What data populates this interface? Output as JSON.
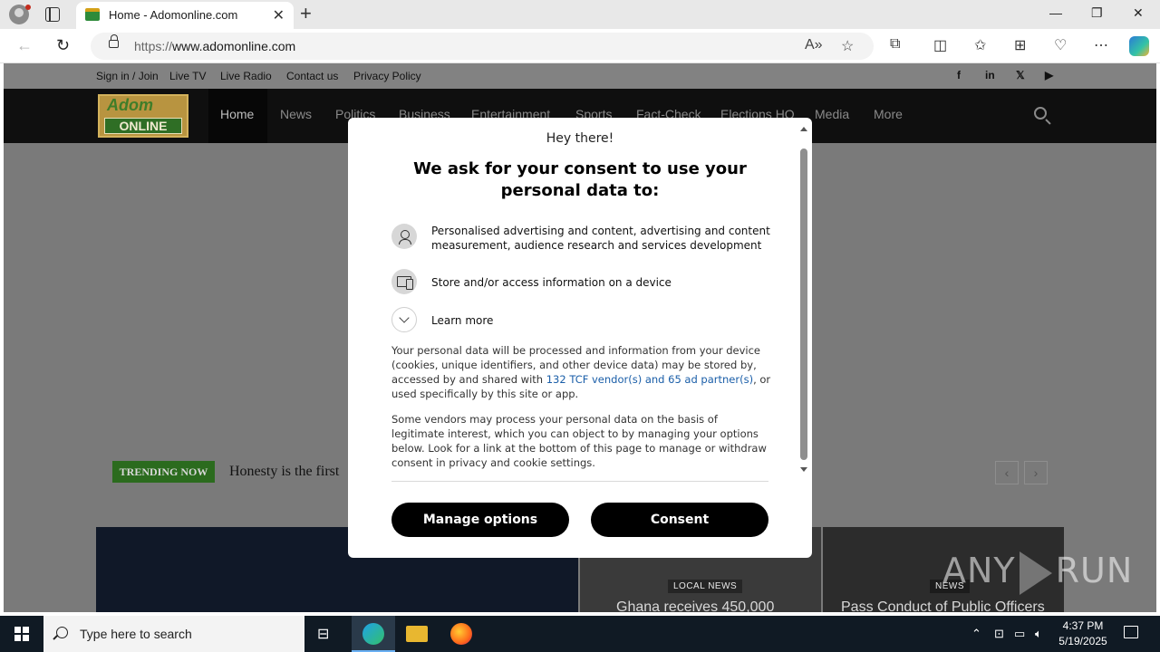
{
  "browser": {
    "tab_title": "Home - Adomonline.com",
    "url_scheme": "https://",
    "url_host": "www.adomonline.com"
  },
  "site": {
    "topbar_links": [
      "Sign in / Join",
      "Live TV",
      "Live Radio",
      "Contact us",
      "Privacy Policy"
    ],
    "social": [
      "f",
      "in",
      "𝕏",
      "▶"
    ],
    "logo": {
      "line1": "Adom",
      "line2": "ONLINE"
    },
    "nav": [
      "Home",
      "News",
      "Politics",
      "Business",
      "Entertainment",
      "Sports",
      "Fact-Check",
      "Elections HQ",
      "Media",
      "More"
    ],
    "trending_label": "TRENDING NOW",
    "trending_headline": "Honesty is the first",
    "cards": [
      {
        "category": "",
        "title": ""
      },
      {
        "category": "LOCAL NEWS",
        "title": "Ghana receives 450,000"
      },
      {
        "category": "NEWS",
        "title": "Pass Conduct of Public Officers"
      }
    ]
  },
  "consent": {
    "greeting": "Hey there!",
    "heading": "We ask for your consent to use your personal data to:",
    "purposes": [
      {
        "icon": "person-icon",
        "text": "Personalised advertising and content, advertising and content measurement, audience research and services development"
      },
      {
        "icon": "device-icon",
        "text": "Store and/or access information on a device"
      }
    ],
    "learn_more": "Learn more",
    "para1_before": "Your personal data will be processed and information from your device (cookies, unique identifiers, and other device data) may be stored by, accessed by and shared with ",
    "para1_link": "132 TCF vendor(s) and 65 ad partner(s)",
    "para1_after": ", or used specifically by this site or app.",
    "para2": "Some vendors may process your personal data on the basis of legitimate interest, which you can object to by managing your options below. Look for a link at the bottom of this page to manage or withdraw consent in privacy and cookie settings.",
    "manage_button": "Manage options",
    "consent_button": "Consent"
  },
  "watermark": {
    "left": "ANY",
    "right": "RUN"
  },
  "taskbar": {
    "search_placeholder": "Type here to search",
    "time": "4:37 PM",
    "date": "5/19/2025"
  }
}
